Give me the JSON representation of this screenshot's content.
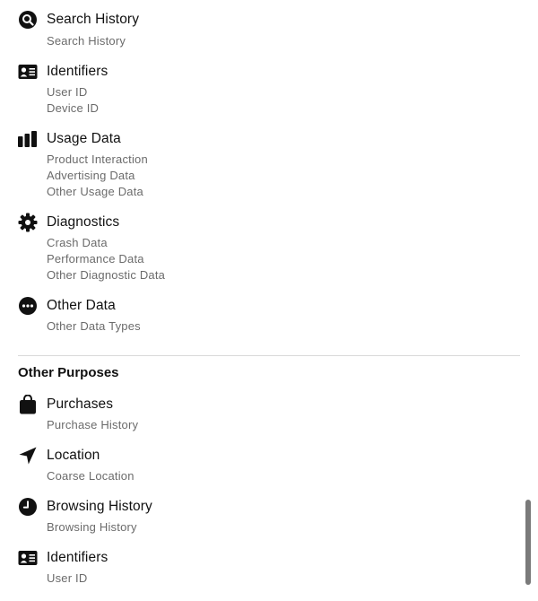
{
  "categories_top": [
    {
      "icon": "search-icon",
      "title": "Search History",
      "items": [
        "Search History"
      ]
    },
    {
      "icon": "id-card-icon",
      "title": "Identifiers",
      "items": [
        "User ID",
        "Device ID"
      ]
    },
    {
      "icon": "bar-chart-icon",
      "title": "Usage Data",
      "items": [
        "Product Interaction",
        "Advertising Data",
        "Other Usage Data"
      ]
    },
    {
      "icon": "gear-icon",
      "title": "Diagnostics",
      "items": [
        "Crash Data",
        "Performance Data",
        "Other Diagnostic Data"
      ]
    },
    {
      "icon": "more-icon",
      "title": "Other Data",
      "items": [
        "Other Data Types"
      ]
    }
  ],
  "other_purposes": {
    "heading": "Other Purposes",
    "categories": [
      {
        "icon": "bag-icon",
        "title": "Purchases",
        "items": [
          "Purchase History"
        ]
      },
      {
        "icon": "location-arrow-icon",
        "title": "Location",
        "items": [
          "Coarse Location"
        ]
      },
      {
        "icon": "clock-icon",
        "title": "Browsing History",
        "items": [
          "Browsing History"
        ]
      },
      {
        "icon": "id-card-icon",
        "title": "Identifiers",
        "items": [
          "User ID"
        ]
      }
    ]
  }
}
